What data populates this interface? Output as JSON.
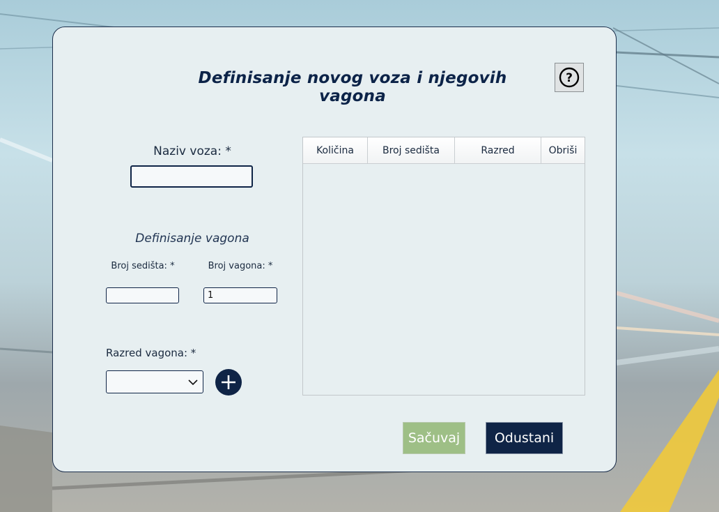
{
  "dialog": {
    "title": "Definisanje novog voza i njegovih vagona",
    "help_symbol": "?"
  },
  "form": {
    "train_name_label": "Naziv voza: *",
    "train_name_value": "",
    "wagon_section_title": "Definisanje vagona",
    "seats_label": "Broj sedišta: *",
    "seats_value": "",
    "wagons_label": "Broj vagona: *",
    "wagons_value": "1",
    "class_label": "Razred vagona: *",
    "class_value": ""
  },
  "table": {
    "columns": [
      "Količina",
      "Broj sedišta",
      "Razred",
      "Obriši"
    ],
    "rows": []
  },
  "actions": {
    "save_label": "Sačuvaj",
    "cancel_label": "Odustani"
  },
  "colors": {
    "accent": "#0f2446",
    "save": "#9ebf86",
    "panel": "#e7eff1"
  },
  "icons": {
    "help": "question-circle-icon",
    "add": "plus-circle-icon",
    "dropdown": "chevron-down-icon"
  }
}
